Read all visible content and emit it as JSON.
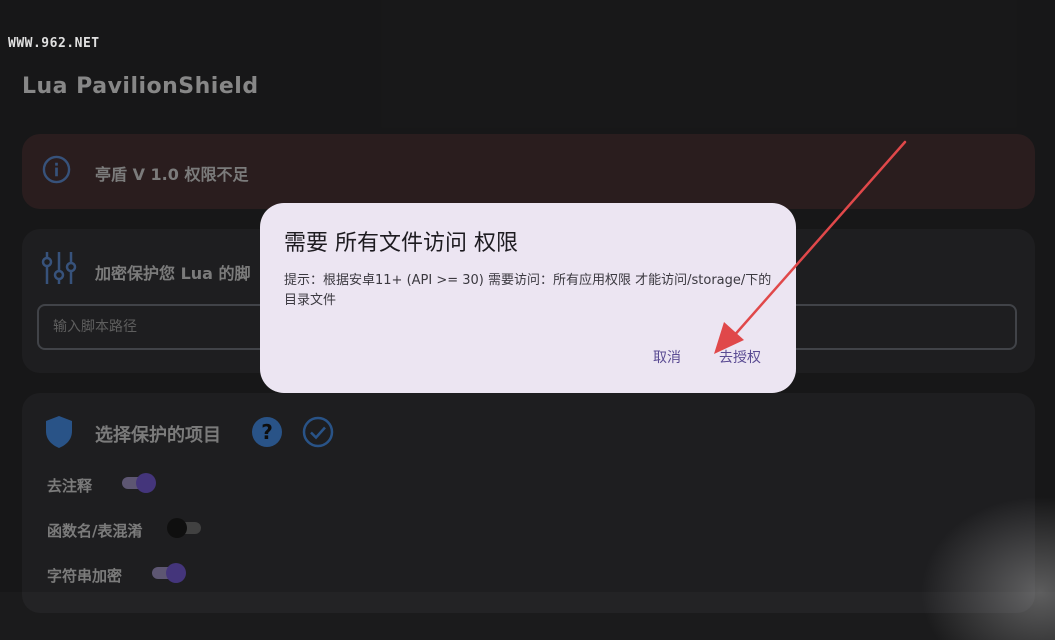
{
  "watermark": "WWW.962.NET",
  "app": {
    "title": "Lua PavilionShield"
  },
  "warning": {
    "text": "亭盾 V 1.0 权限不足",
    "icon": "info-icon"
  },
  "script": {
    "title": "加密保护您 Lua 的脚",
    "input_placeholder": "输入脚本路径",
    "icon": "tune-icon"
  },
  "options": {
    "title": "选择保护的项目",
    "items": [
      {
        "label": "去注释",
        "enabled": true
      },
      {
        "label": "函数名/表混淆",
        "enabled": false
      },
      {
        "label": "字符串加密",
        "enabled": true
      }
    ]
  },
  "dialog": {
    "title": "需要 所有文件访问 权限",
    "message": "提示：根据安卓11+ (API >= 30) 需要访问：所有应用权限 才能访问/storage/下的目录文件",
    "cancel_label": "取消",
    "grant_label": "去授权"
  },
  "colors": {
    "background": "#1b1b1c",
    "dialog_bg": "#ece5f2",
    "accent": "#5a4b93",
    "annotation_arrow": "#e0484a"
  }
}
